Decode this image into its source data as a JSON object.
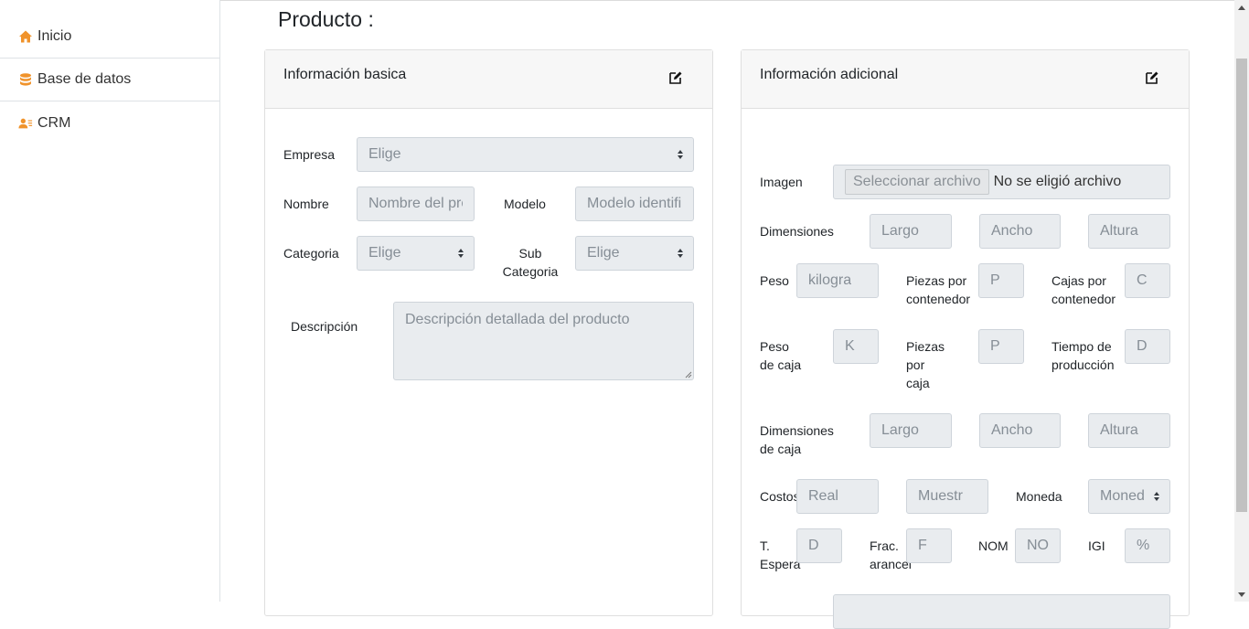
{
  "sidebar": {
    "items": [
      {
        "label": "Inicio",
        "icon": "home-icon"
      },
      {
        "label": "Base de datos",
        "icon": "database-icon"
      },
      {
        "label": "CRM",
        "icon": "users-icon"
      }
    ],
    "accent": "#f0932b"
  },
  "page": {
    "title": "Producto :"
  },
  "basic": {
    "title": "Información basica",
    "empresa_label": "Empresa",
    "empresa_value": "Elige",
    "nombre_label": "Nombre",
    "nombre_placeholder": "Nombre del pro",
    "modelo_label": "Modelo",
    "modelo_placeholder": "Modelo identifi",
    "categoria_label": "Categoria",
    "categoria_value": "Elige",
    "subcategoria_label_1": "Sub",
    "subcategoria_label_2": "Categoria",
    "subcategoria_value": "Elige",
    "descripcion_label": "Descripción",
    "descripcion_placeholder": "Descripción detallada del producto"
  },
  "additional": {
    "title": "Información adicional",
    "imagen_label": "Imagen",
    "file_button": "Seleccionar archivo",
    "file_status": "No se eligió archivo",
    "dimensiones_label": "Dimensiones",
    "largo": "Largo",
    "ancho": "Ancho",
    "altura": "Altura",
    "peso_label": "Peso",
    "peso_placeholder": "kilogra",
    "piezas_contenedor_label_1": "Piezas por",
    "piezas_contenedor_label_2": "contenedor",
    "piezas_contenedor_placeholder": "P",
    "cajas_contenedor_label_1": "Cajas por",
    "cajas_contenedor_label_2": "contenedor",
    "cajas_contenedor_placeholder": "C",
    "peso_caja_label_1": "Peso",
    "peso_caja_label_2": "de caja",
    "peso_caja_placeholder": "K",
    "piezas_caja_label_1": "Piezas",
    "piezas_caja_label_2": "por",
    "piezas_caja_label_3": "caja",
    "piezas_caja_placeholder": "P",
    "tiempo_label_1": "Tiempo de",
    "tiempo_label_2": "producción",
    "tiempo_placeholder": "D",
    "dim_caja_label_1": "Dimensiones",
    "dim_caja_label_2": "de caja",
    "costos_label": "Costos",
    "costo_real": "Real",
    "costo_muestra": "Muestr",
    "moneda_label": "Moneda",
    "moneda_value": "Moned",
    "tespera_label_1": "T.",
    "tespera_label_2": "Espera",
    "tespera_placeholder": "D",
    "frac_label_1": "Frac.",
    "frac_label_2": "arancel",
    "frac_placeholder": "F",
    "nom_label": "NOM",
    "nom_placeholder": "NO",
    "igi_label": "IGI",
    "igi_placeholder": "%"
  }
}
